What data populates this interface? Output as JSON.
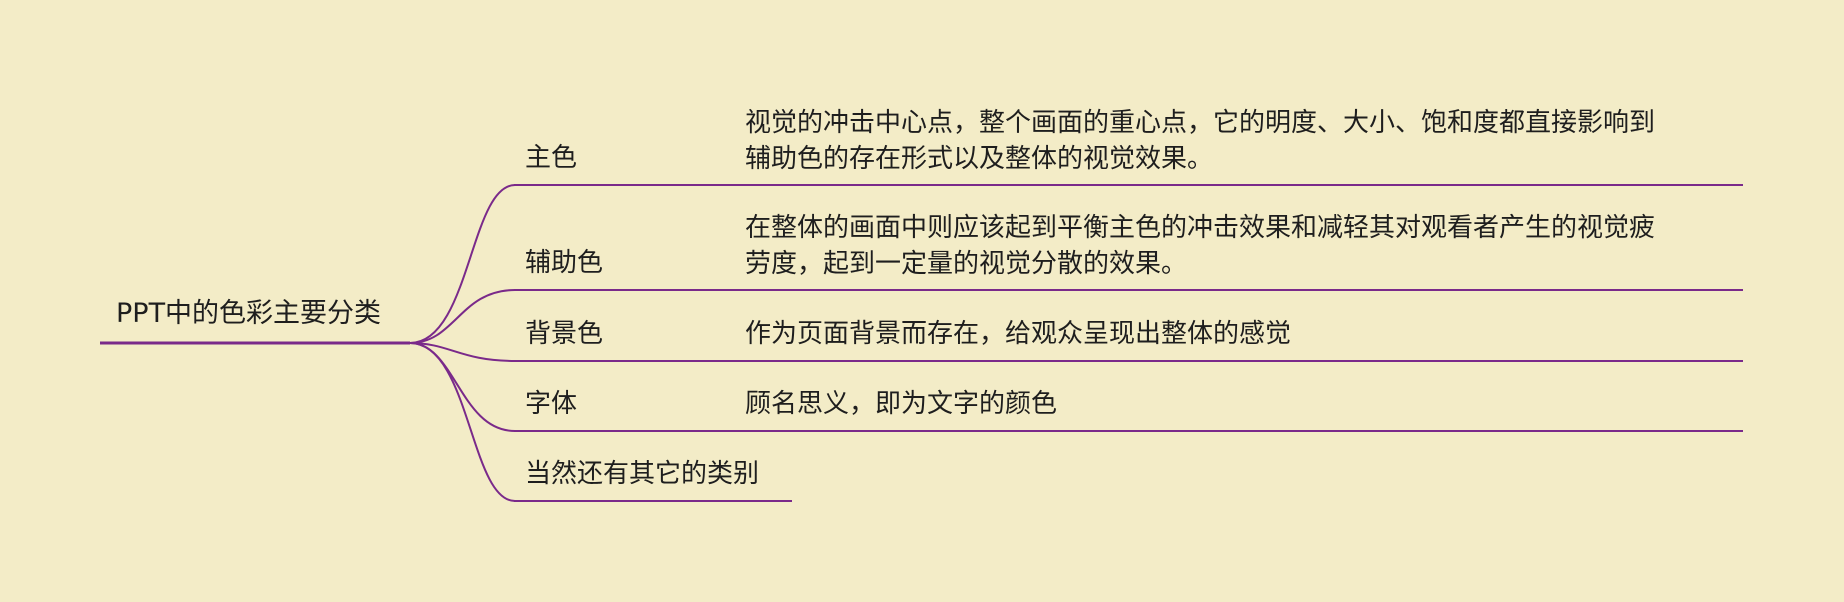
{
  "diagram": {
    "root": "PPT中的色彩主要分类",
    "branches": [
      {
        "label": "主色",
        "detail_lines": [
          "视觉的冲击中心点，整个画面的重心点，它的明度、大小、饱和度都直接影响到",
          "辅助色的存在形式以及整体的视觉效果。"
        ]
      },
      {
        "label": "辅助色",
        "detail_lines": [
          "在整体的画面中则应该起到平衡主色的冲击效果和减轻其对观看者产生的视觉疲",
          "劳度，起到一定量的视觉分散的效果。"
        ]
      },
      {
        "label": "背景色",
        "detail_lines": [
          "作为页面背景而存在，给观众呈现出整体的感觉"
        ]
      },
      {
        "label": "字体",
        "detail_lines": [
          "顾名思义，即为文字的颜色"
        ]
      },
      {
        "label": "当然还有其它的类别",
        "detail_lines": []
      }
    ]
  },
  "colors": {
    "background": "#f3ecc7",
    "line": "#7a2a8a",
    "text": "#1e1e1e"
  }
}
